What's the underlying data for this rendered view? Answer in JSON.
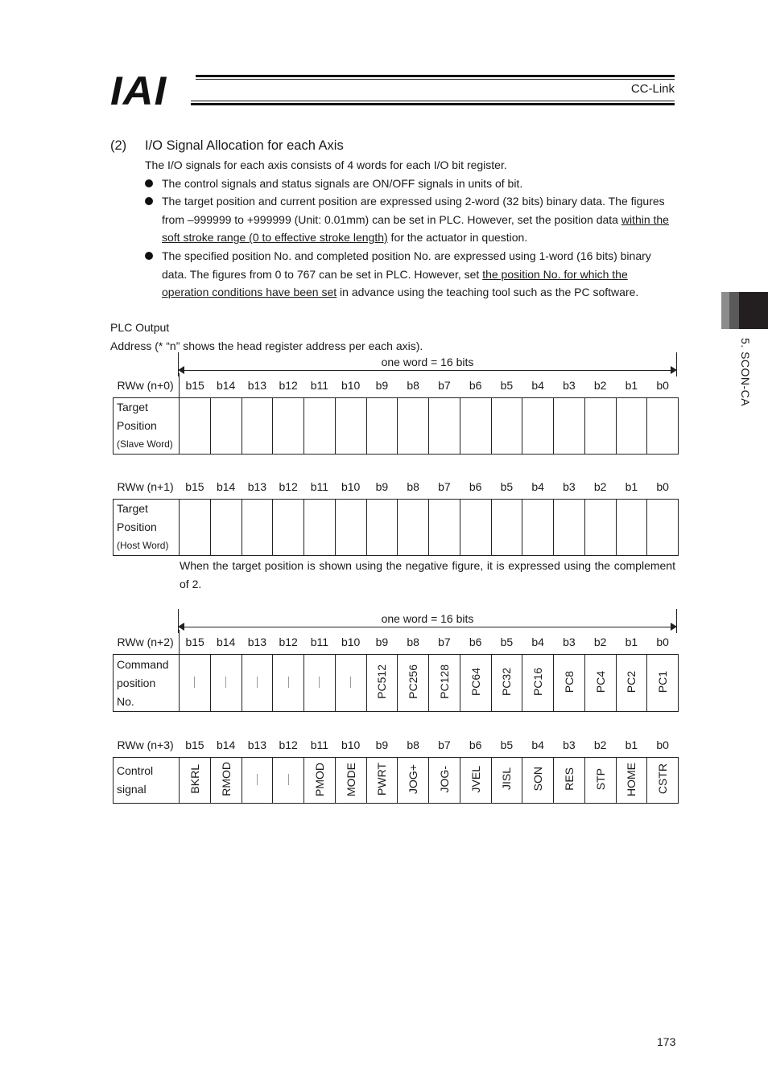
{
  "header": {
    "logo": "IAI",
    "title": "CC-Link"
  },
  "side_tab": {
    "label": "5. SCON-CA"
  },
  "section": {
    "number": "(2)",
    "title": "I/O Signal Allocation for each Axis",
    "intro": "The I/O signals for each axis consists of 4 words for each I/O bit register.",
    "bullets": [
      {
        "segments": [
          {
            "text": "The control signals and status signals are ON/OFF signals in units of bit.",
            "underline": false
          }
        ]
      },
      {
        "segments": [
          {
            "text": "The target position and current position are expressed using 2-word (32 bits) binary data. The figures from –999999 to +999999 (Unit: 0.01mm) can be set in PLC. However, set the position data ",
            "underline": false
          },
          {
            "text": "within the soft stroke range (0 to effective stroke length)",
            "underline": true
          },
          {
            "text": " for the actuator in question.",
            "underline": false
          }
        ]
      },
      {
        "segments": [
          {
            "text": "The specified position No. and completed position No. are expressed using 1-word (16 bits) binary data. The figures from 0 to 767 can be set in PLC. However, set ",
            "underline": false
          },
          {
            "text": "the position No. for which the operation conditions have been set",
            "underline": true
          },
          {
            "text": " in advance using the teaching tool such as the PC software.",
            "underline": false
          }
        ]
      }
    ]
  },
  "plc": {
    "heading": "PLC Output",
    "address_note": "Address (* “n” shows the head register address per each axis).",
    "word_label": "one word = 16 bits",
    "bit_headers": [
      "b15",
      "b14",
      "b13",
      "b12",
      "b11",
      "b10",
      "b9",
      "b8",
      "b7",
      "b6",
      "b5",
      "b4",
      "b3",
      "b2",
      "b1",
      "b0"
    ],
    "registers": [
      {
        "address": "RWw (n+0)",
        "label_lines": [
          "Target",
          "Position"
        ],
        "label_small": "(Slave Word)",
        "cells": [
          "",
          "",
          "",
          "",
          "",
          "",
          "",
          "",
          "",
          "",
          "",
          "",
          "",
          "",
          "",
          ""
        ]
      },
      {
        "address": "RWw (n+1)",
        "label_lines": [
          "Target",
          "Position"
        ],
        "label_small": "(Host Word)",
        "cells": [
          "",
          "",
          "",
          "",
          "",
          "",
          "",
          "",
          "",
          "",
          "",
          "",
          "",
          "",
          "",
          ""
        ],
        "note": "When the target position is shown using the negative figure, it is expressed using the complement of 2."
      },
      {
        "address": "RWw (n+2)",
        "label_lines": [
          "Command",
          "position",
          "No."
        ],
        "label_small": "",
        "cells": [
          "—",
          "—",
          "—",
          "—",
          "—",
          "—",
          "PC512",
          "PC256",
          "PC128",
          "PC64",
          "PC32",
          "PC16",
          "PC8",
          "PC4",
          "PC2",
          "PC1"
        ]
      },
      {
        "address": "RWw (n+3)",
        "label_lines": [
          "Control",
          "signal"
        ],
        "label_small": "",
        "cells": [
          "BKRL",
          "RMOD",
          "—",
          "—",
          "PMOD",
          "MODE",
          "PWRT",
          "JOG+",
          "JOG-",
          "JVEL",
          "JISL",
          "SON",
          "RES",
          "STP",
          "HOME",
          "CSTR"
        ]
      }
    ]
  },
  "footer": {
    "page_number": "173"
  }
}
